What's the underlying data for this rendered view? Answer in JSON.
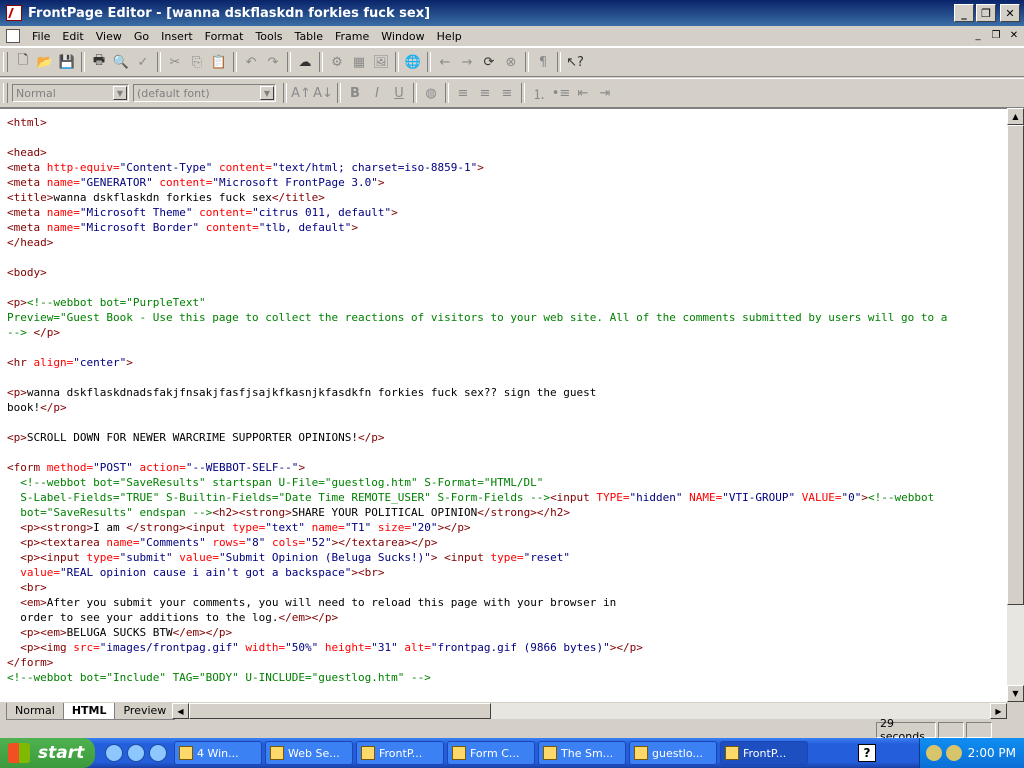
{
  "window": {
    "title": "FrontPage Editor - [wanna dskflaskdn forkies fuck sex]"
  },
  "menu": [
    "File",
    "Edit",
    "View",
    "Go",
    "Insert",
    "Format",
    "Tools",
    "Table",
    "Frame",
    "Window",
    "Help"
  ],
  "format_toolbar": {
    "style_value": "Normal",
    "font_value": "(default font)"
  },
  "code_lines": [
    [
      [
        "t",
        "<html>"
      ]
    ],
    [],
    [
      [
        "t",
        "<head>"
      ]
    ],
    [
      [
        "t",
        "<meta "
      ],
      [
        "a",
        "http-equiv="
      ],
      [
        "v",
        "\"Content-Type\""
      ],
      [
        "a",
        " content="
      ],
      [
        "v",
        "\"text/html; charset=iso-8859-1\""
      ],
      [
        "t",
        ">"
      ]
    ],
    [
      [
        "t",
        "<meta "
      ],
      [
        "a",
        "name="
      ],
      [
        "v",
        "\"GENERATOR\""
      ],
      [
        "a",
        " content="
      ],
      [
        "v",
        "\"Microsoft FrontPage 3.0\""
      ],
      [
        "t",
        ">"
      ]
    ],
    [
      [
        "t",
        "<title>"
      ],
      [
        "x",
        "wanna dskflaskdn forkies fuck sex"
      ],
      [
        "t",
        "</title>"
      ]
    ],
    [
      [
        "t",
        "<meta "
      ],
      [
        "a",
        "name="
      ],
      [
        "v",
        "\"Microsoft Theme\""
      ],
      [
        "a",
        " content="
      ],
      [
        "v",
        "\"citrus 011, default\""
      ],
      [
        "t",
        ">"
      ]
    ],
    [
      [
        "t",
        "<meta "
      ],
      [
        "a",
        "name="
      ],
      [
        "v",
        "\"Microsoft Border\""
      ],
      [
        "a",
        " content="
      ],
      [
        "v",
        "\"tlb, default\""
      ],
      [
        "t",
        ">"
      ]
    ],
    [
      [
        "t",
        "</head>"
      ]
    ],
    [],
    [
      [
        "t",
        "<body>"
      ]
    ],
    [],
    [
      [
        "t",
        "<p>"
      ],
      [
        "c",
        "<!--webbot bot=\"PurpleText\""
      ]
    ],
    [
      [
        "c",
        "Preview=\"Guest Book - Use this page to collect the reactions of visitors to your web site. All of the comments submitted by users will go to a"
      ]
    ],
    [
      [
        "c",
        "--> "
      ],
      [
        "t",
        "</p>"
      ]
    ],
    [],
    [
      [
        "t",
        "<hr "
      ],
      [
        "a",
        "align="
      ],
      [
        "v",
        "\"center\""
      ],
      [
        "t",
        ">"
      ]
    ],
    [],
    [
      [
        "t",
        "<p>"
      ],
      [
        "x",
        "wanna dskflaskdnadsfakjfnsakjfasfjsajkfkasnjkfasdkfn forkies fuck sex?? sign the guest"
      ]
    ],
    [
      [
        "x",
        "book!"
      ],
      [
        "t",
        "</p>"
      ]
    ],
    [],
    [
      [
        "t",
        "<p>"
      ],
      [
        "x",
        "SCROLL DOWN FOR NEWER WARCRIME SUPPORTER OPINIONS!"
      ],
      [
        "t",
        "</p>"
      ]
    ],
    [],
    [
      [
        "t",
        "<form "
      ],
      [
        "a",
        "method="
      ],
      [
        "v",
        "\"POST\""
      ],
      [
        "a",
        " action="
      ],
      [
        "v",
        "\"--WEBBOT-SELF--\""
      ],
      [
        "t",
        ">"
      ]
    ],
    [
      [
        "c",
        "  <!--webbot bot=\"SaveResults\" startspan U-File=\"guestlog.htm\" S-Format=\"HTML/DL\""
      ]
    ],
    [
      [
        "c",
        "  S-Label-Fields=\"TRUE\" S-Builtin-Fields=\"Date Time REMOTE_USER\" S-Form-Fields -->"
      ],
      [
        "t",
        "<input "
      ],
      [
        "a",
        "TYPE="
      ],
      [
        "v",
        "\"hidden\""
      ],
      [
        "a",
        " NAME="
      ],
      [
        "v",
        "\"VTI-GROUP\""
      ],
      [
        "a",
        " VALUE="
      ],
      [
        "v",
        "\"0\""
      ],
      [
        "t",
        ">"
      ],
      [
        "c",
        "<!--webbot"
      ]
    ],
    [
      [
        "c",
        "  bot=\"SaveResults\" endspan -->"
      ],
      [
        "t",
        "<h2><strong>"
      ],
      [
        "x",
        "SHARE YOUR POLITICAL OPINION"
      ],
      [
        "t",
        "</strong></h2>"
      ]
    ],
    [
      [
        "t",
        "  <p><strong>"
      ],
      [
        "x",
        "I am "
      ],
      [
        "t",
        "</strong><input "
      ],
      [
        "a",
        "type="
      ],
      [
        "v",
        "\"text\""
      ],
      [
        "a",
        " name="
      ],
      [
        "v",
        "\"T1\""
      ],
      [
        "a",
        " size="
      ],
      [
        "v",
        "\"20\""
      ],
      [
        "t",
        "></p>"
      ]
    ],
    [
      [
        "t",
        "  <p><textarea "
      ],
      [
        "a",
        "name="
      ],
      [
        "v",
        "\"Comments\""
      ],
      [
        "a",
        " rows="
      ],
      [
        "v",
        "\"8\""
      ],
      [
        "a",
        " cols="
      ],
      [
        "v",
        "\"52\""
      ],
      [
        "t",
        "></textarea></p>"
      ]
    ],
    [
      [
        "t",
        "  <p><input "
      ],
      [
        "a",
        "type="
      ],
      [
        "v",
        "\"submit\""
      ],
      [
        "a",
        " value="
      ],
      [
        "v",
        "\"Submit Opinion (Beluga Sucks!)\""
      ],
      [
        "t",
        "> <input "
      ],
      [
        "a",
        "type="
      ],
      [
        "v",
        "\"reset\""
      ]
    ],
    [
      [
        "a",
        "  value="
      ],
      [
        "v",
        "\"REAL opinion cause i ain't got a backspace\""
      ],
      [
        "t",
        "><br>"
      ]
    ],
    [
      [
        "t",
        "  <br>"
      ]
    ],
    [
      [
        "t",
        "  <em>"
      ],
      [
        "x",
        "After you submit your comments, you will need to reload this page with your browser in"
      ]
    ],
    [
      [
        "x",
        "  order to see your additions to the log."
      ],
      [
        "t",
        "</em></p>"
      ]
    ],
    [
      [
        "t",
        "  <p><em>"
      ],
      [
        "x",
        "BELUGA SUCKS BTW"
      ],
      [
        "t",
        "</em></p>"
      ]
    ],
    [
      [
        "t",
        "  <p><img "
      ],
      [
        "a",
        "src="
      ],
      [
        "v",
        "\"images/frontpag.gif\""
      ],
      [
        "a",
        " width="
      ],
      [
        "v",
        "\"50%\""
      ],
      [
        "a",
        " height="
      ],
      [
        "v",
        "\"31\""
      ],
      [
        "a",
        " alt="
      ],
      [
        "v",
        "\"frontpag.gif (9866 bytes)\""
      ],
      [
        "t",
        "></p>"
      ]
    ],
    [
      [
        "t",
        "</form>"
      ]
    ],
    [
      [
        "c",
        "<!--webbot bot=\"Include\" TAG=\"BODY\" U-INCLUDE=\"guestlog.htm\" -->"
      ]
    ]
  ],
  "tabs": {
    "normal": "Normal",
    "html": "HTML",
    "preview": "Preview"
  },
  "status": {
    "time": "29 seconds"
  },
  "taskbar": {
    "start": "start",
    "tasks": [
      "4 Win...",
      "Web Se...",
      "FrontP...",
      "Form C...",
      "The Sm...",
      "guestlo...",
      "FrontP..."
    ],
    "help": "?",
    "clock": "2:00 PM"
  },
  "colors": {
    "tag": "#800000",
    "attribute": "#ff0000",
    "value": "#000080",
    "comment": "#008000"
  }
}
